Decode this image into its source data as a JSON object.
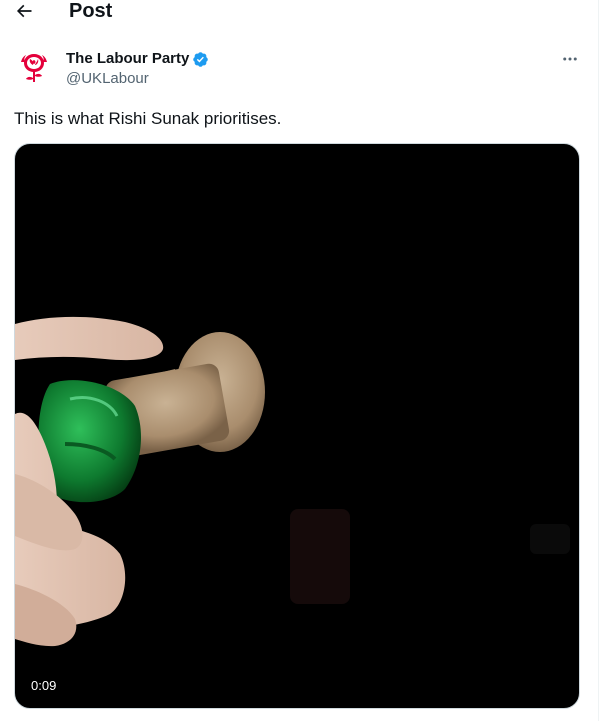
{
  "header": {
    "back_icon": "arrow-left-icon",
    "title": "Post"
  },
  "author": {
    "name": "The Labour Party",
    "handle": "@UKLabour",
    "verified": true,
    "verified_color": "#1d9bf0",
    "avatar_icon": "labour-rose-logo",
    "brand_color": "#e4003b"
  },
  "post": {
    "text": "This is what Rishi Sunak prioritises.",
    "more_icon": "more-horizontal-icon"
  },
  "video": {
    "duration": "0:09",
    "background_color": "#000000"
  }
}
